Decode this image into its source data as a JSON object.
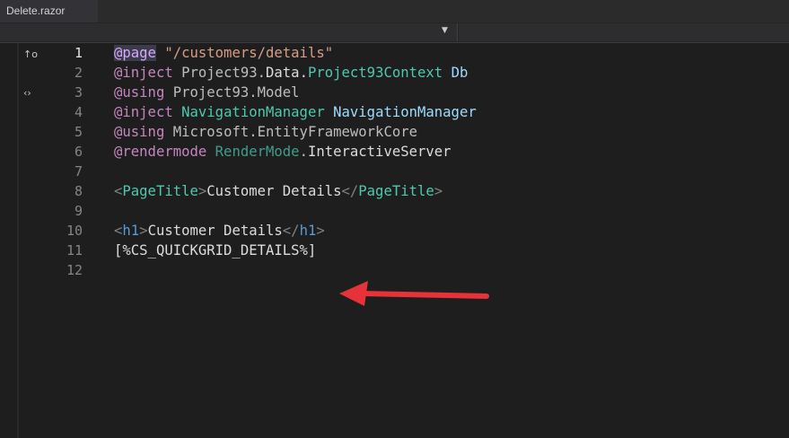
{
  "tab": {
    "title": "Delete.razor"
  },
  "gutter": {
    "glyphs": [
      "↑o",
      "‹›"
    ]
  },
  "lines": {
    "n1": "1",
    "n2": "2",
    "n3": "3",
    "n4": "4",
    "n5": "5",
    "n6": "6",
    "n7": "7",
    "n8": "8",
    "n9": "9",
    "n10": "10",
    "n11": "11",
    "n12": "12"
  },
  "code": {
    "l1": {
      "at": "@",
      "kw": "page",
      "str": "\"/customers/details\""
    },
    "l2": {
      "at": "@",
      "kw": "inject",
      "ns": "Project93.",
      "ns2": "Data.",
      "type": "Project93Context",
      "var": "Db"
    },
    "l3": {
      "at": "@",
      "kw": "using",
      "rest": "Project93.Model"
    },
    "l4": {
      "at": "@",
      "kw": "inject",
      "type": "NavigationManager",
      "var": "NavigationManager"
    },
    "l5": {
      "at": "@",
      "kw": "using",
      "rest": "Microsoft.EntityFrameworkCore"
    },
    "l6": {
      "at": "@",
      "kw": "rendermode",
      "type": "RenderMode",
      "dot": ".",
      "rest": "InteractiveServer"
    },
    "l8": {
      "open_lt": "<",
      "tag": "PageTitle",
      "open_gt": ">",
      "text": "Customer Details",
      "close_lt": "</",
      "close_tag": "PageTitle",
      "close_gt": ">"
    },
    "l10": {
      "open_lt": "<",
      "tag": "h1",
      "open_gt": ">",
      "text": "Customer Details",
      "close_lt": "</",
      "close_tag": "h1",
      "close_gt": ">"
    },
    "l11": {
      "text": "[%CS_QUICKGRID_DETAILS%]"
    }
  },
  "colors": {
    "arrow": "#e8323a"
  }
}
